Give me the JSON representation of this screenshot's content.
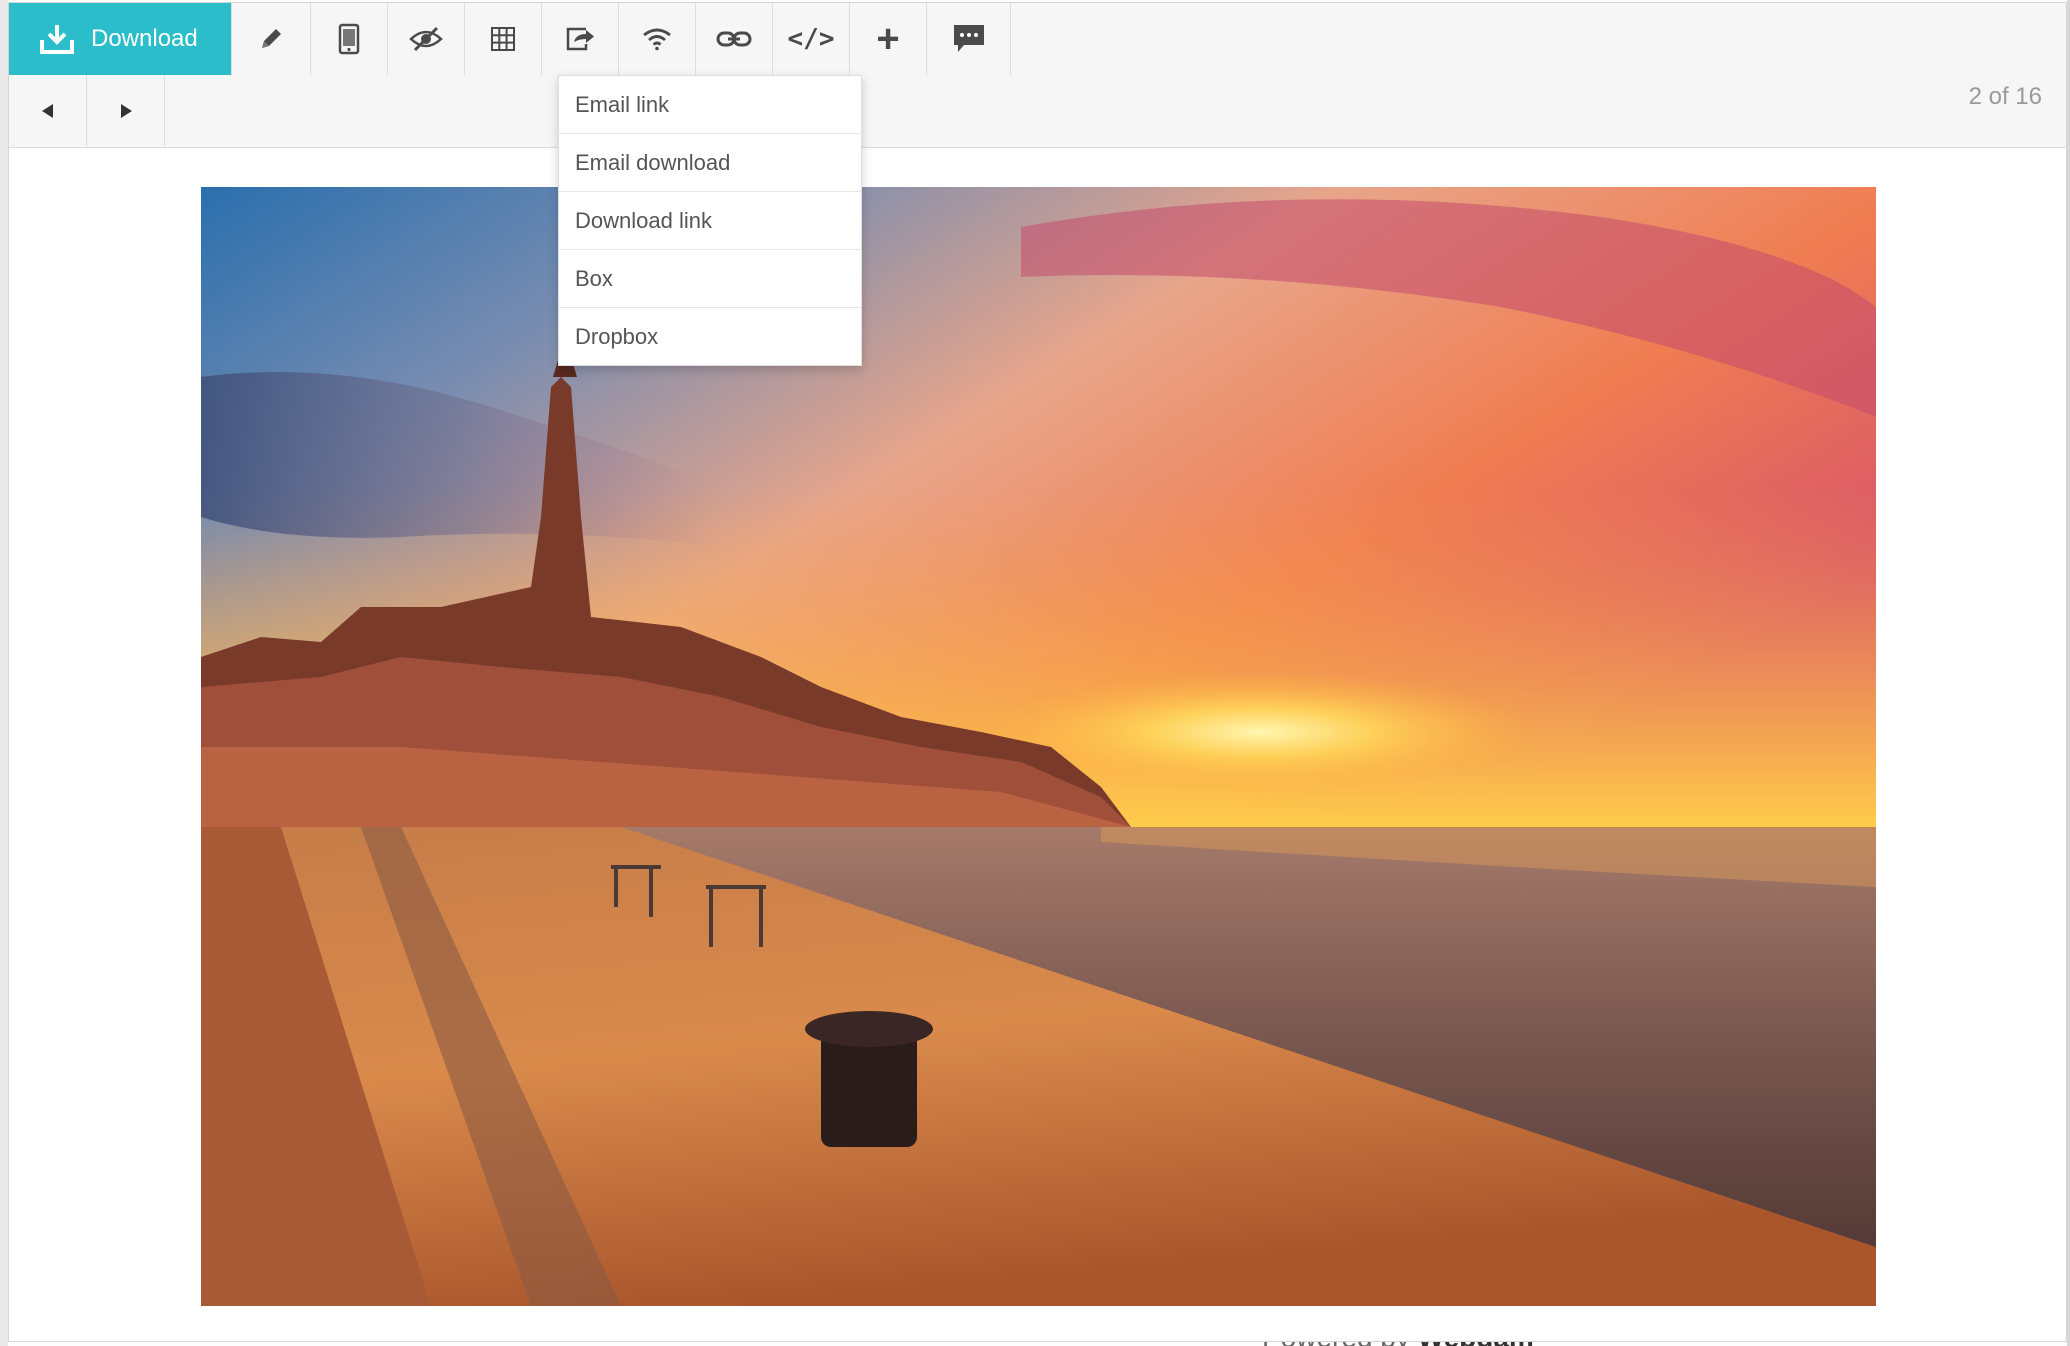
{
  "toolbar": {
    "download_label": "Download",
    "accent_color": "#2bbdc9",
    "tools": [
      {
        "icon": "pencil-icon"
      },
      {
        "icon": "phone-icon"
      },
      {
        "icon": "eye-slash-icon"
      },
      {
        "icon": "grid-icon"
      },
      {
        "icon": "share-icon"
      },
      {
        "icon": "wifi-icon"
      },
      {
        "icon": "link-icon"
      },
      {
        "icon": "code-icon",
        "label": "</>"
      },
      {
        "icon": "plus-icon",
        "label": "+"
      },
      {
        "icon": "comment-icon"
      }
    ]
  },
  "navigation": {
    "prev_icon": "triangle-left-icon",
    "next_icon": "triangle-right-icon",
    "page_counter": "2 of 16"
  },
  "share_menu": {
    "items": [
      "Email link",
      "Email download",
      "Download link",
      "Box",
      "Dropbox"
    ]
  },
  "footer": {
    "text_prefix": "Powered by ",
    "brand": "Webdam"
  }
}
